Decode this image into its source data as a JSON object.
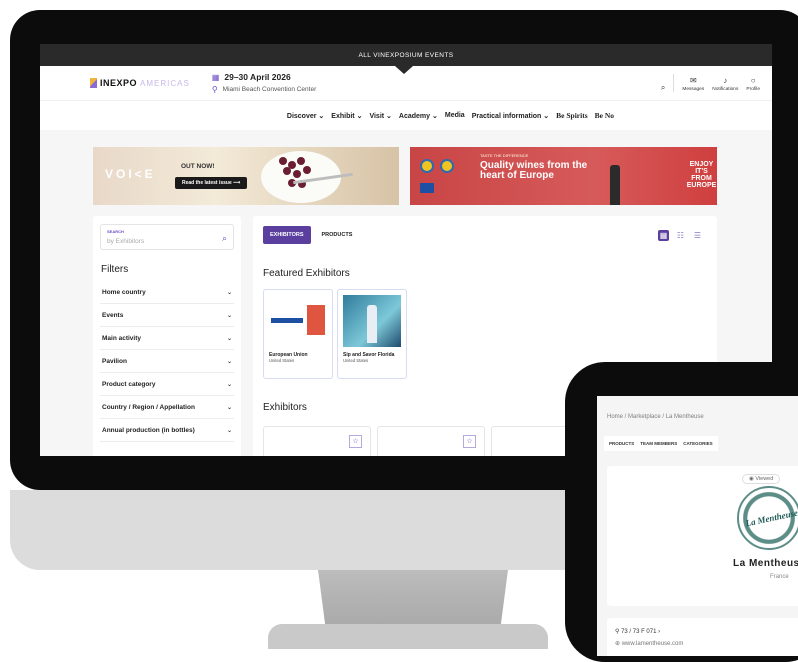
{
  "announcement": "ALL VINEXPOSIUM EVENTS",
  "header": {
    "logo_main": "INEXPO",
    "logo_sub": "AMERICAS",
    "date": "29–30 April 2026",
    "venue": "Miami Beach Convention Center",
    "actions": [
      {
        "label": "Messages",
        "icon": "envelope-icon"
      },
      {
        "label": "Notifications",
        "icon": "bell-icon"
      },
      {
        "label": "Profile",
        "icon": "user-icon"
      }
    ]
  },
  "nav": {
    "items": [
      "Discover",
      "Exhibit",
      "Visit",
      "Academy",
      "Media",
      "Practical information"
    ],
    "bespirits": "Be Spirits",
    "beno": "Be No"
  },
  "banners": {
    "voice": {
      "brand": "VOI<E",
      "headline": "OUT NOW!",
      "cta": "Read the latest issue"
    },
    "eu": {
      "kicker": "TASTE THE DIFFERENCE",
      "headline_1": "Quality wines from the",
      "headline_2": "heart of Europe",
      "enjoy_1": "ENJOY",
      "enjoy_2": "IT'S FROM",
      "enjoy_3": "EUROPE"
    }
  },
  "sidebar": {
    "search_label": "SEARCH",
    "search_placeholder": "by Exhibitors",
    "filters_title": "Filters",
    "filters": [
      "Home country",
      "Events",
      "Main activity",
      "Pavilion",
      "Product category",
      "Country / Region / Appellation",
      "Annual production (in bottles)"
    ]
  },
  "content": {
    "tabs": [
      "EXHIBITORS",
      "PRODUCTS"
    ],
    "featured_title": "Featured Exhibitors",
    "featured": [
      {
        "name": "European Union",
        "country": "United States"
      },
      {
        "name": "Sip and Savor Florida",
        "country": "United States"
      }
    ],
    "exhibitors_title": "Exhibitors"
  },
  "tablet": {
    "breadcrumb": "Home / Marketplace / La Mentheuse",
    "tabs": [
      "PRODUCTS",
      "TEAM MEMBERS",
      "CATEGORIES"
    ],
    "viewed": "Viewed",
    "seal_text": "La Mentheuse",
    "name": "La Mentheuse",
    "country": "France",
    "phone": "73 / 73 F 071",
    "website": "www.lamentheuse.com"
  }
}
